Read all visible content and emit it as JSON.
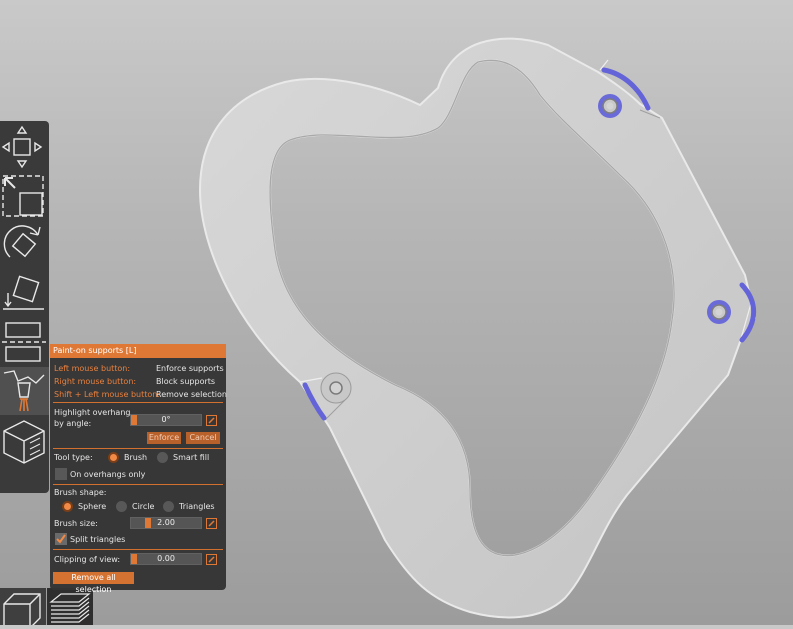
{
  "colors": {
    "accent": "#e07835",
    "accent_text": "#e9803e",
    "panel_bg": "#343434",
    "toolbar_bg": "#3a3a3a",
    "model_gray": "#cccccc",
    "support_paint": "#6b6bd9"
  },
  "toolbar": {
    "tools": [
      {
        "icon": "move-icon"
      },
      {
        "icon": "scale-icon"
      },
      {
        "icon": "rotate-icon"
      },
      {
        "icon": "place-on-face-icon"
      },
      {
        "icon": "cut-icon"
      },
      {
        "icon": "paint-supports-icon",
        "active": true
      },
      {
        "icon": "seam-cube-icon"
      }
    ]
  },
  "views": {
    "items": [
      {
        "icon": "3d-view-icon",
        "active": true
      },
      {
        "icon": "preview-layers-icon",
        "active": false
      }
    ]
  },
  "panel": {
    "title": "Paint-on supports [L]",
    "hotkeys": [
      {
        "key": "Left mouse button:",
        "action": "Enforce supports"
      },
      {
        "key": "Right mouse button:",
        "action": "Block supports"
      },
      {
        "key": "Shift + Left mouse button:",
        "action": "Remove selection"
      }
    ],
    "highlight_label_1": "Highlight overhang",
    "highlight_label_2": "by angle:",
    "highlight_value": "0°",
    "enforce_label": "Enforce",
    "cancel_label": "Cancel",
    "tool_type_label": "Tool type:",
    "tool_types": [
      {
        "label": "Brush",
        "selected": true
      },
      {
        "label": "Smart fill",
        "selected": false
      }
    ],
    "on_overhangs_label": "On overhangs only",
    "on_overhangs_checked": false,
    "brush_shape_label": "Brush shape:",
    "brush_shapes": [
      {
        "label": "Sphere",
        "selected": true
      },
      {
        "label": "Circle",
        "selected": false
      },
      {
        "label": "Triangles",
        "selected": false
      }
    ],
    "brush_size_label": "Brush size:",
    "brush_size_value": "2.00",
    "split_triangles_label": "Split triangles",
    "split_triangles_checked": true,
    "clipping_label": "Clipping of view:",
    "clipping_value": "0.00",
    "remove_all_label": "Remove all selection"
  }
}
